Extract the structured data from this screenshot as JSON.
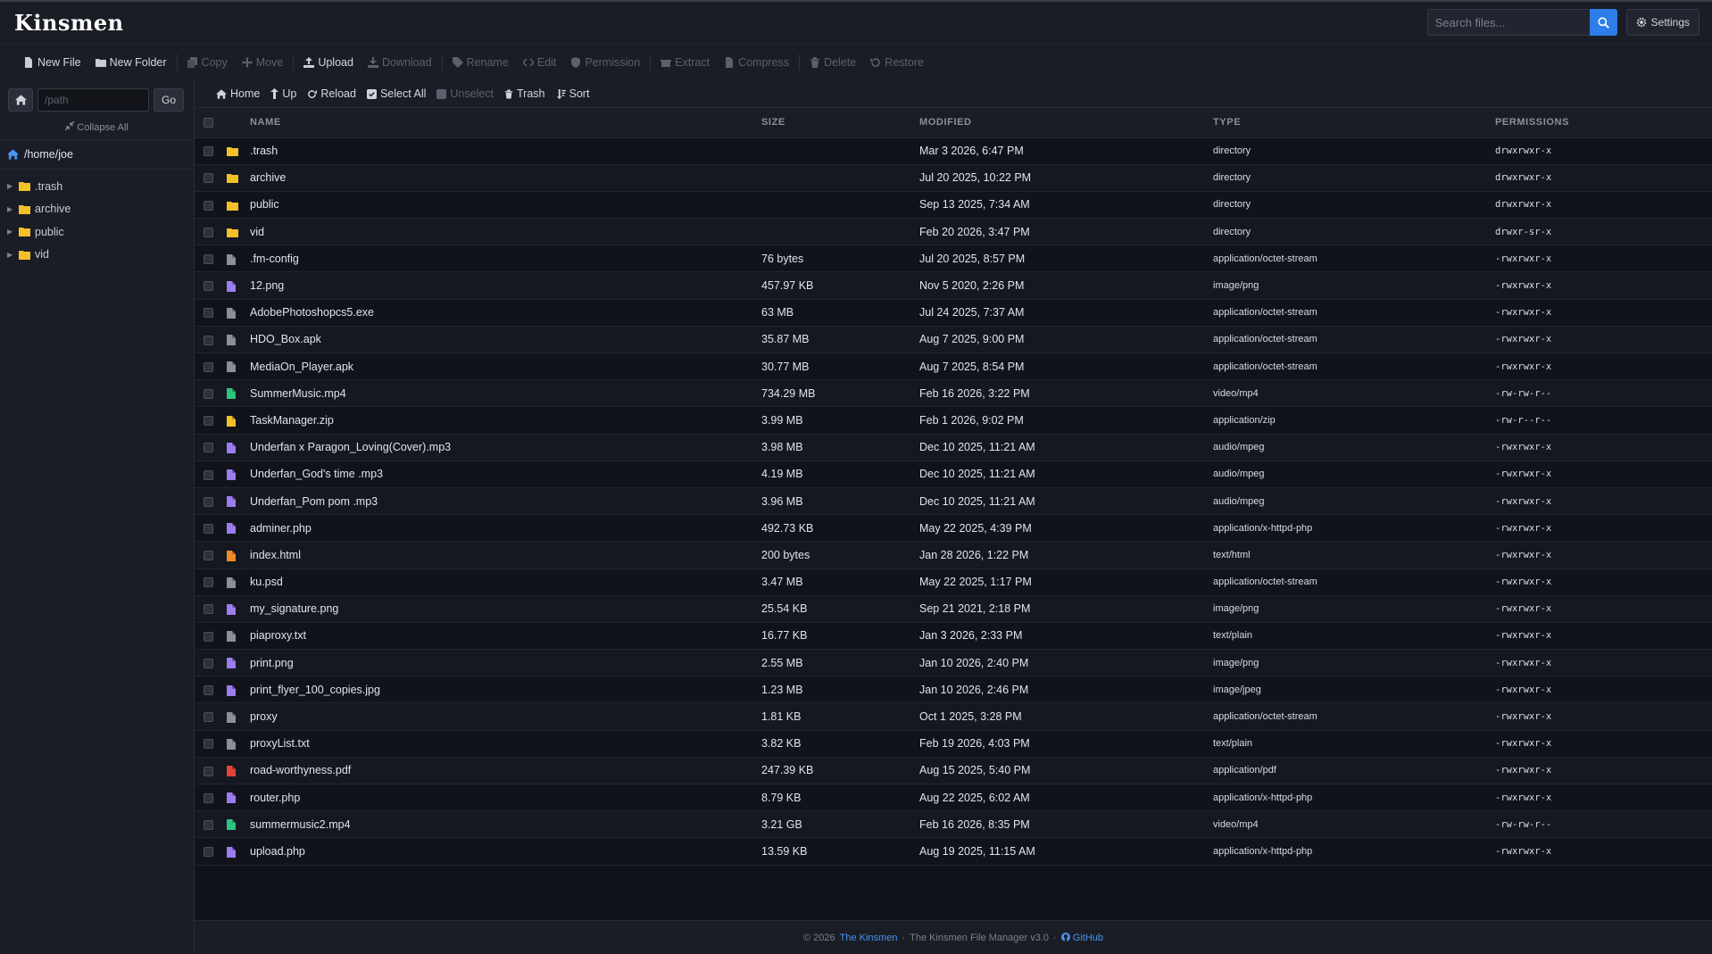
{
  "header": {
    "logo": "Kinsmen",
    "search_placeholder": "Search files...",
    "settings_label": "Settings"
  },
  "toolbar": {
    "new_file": "New File",
    "new_folder": "New Folder",
    "copy": "Copy",
    "move": "Move",
    "upload": "Upload",
    "download": "Download",
    "rename": "Rename",
    "edit": "Edit",
    "permission": "Permission",
    "extract": "Extract",
    "compress": "Compress",
    "delete": "Delete",
    "restore": "Restore"
  },
  "sidebar": {
    "path_placeholder": "/path",
    "go_label": "Go",
    "collapse_label": "Collapse All",
    "root": "/home/joe",
    "tree": [
      {
        "label": ".trash"
      },
      {
        "label": "archive"
      },
      {
        "label": "public"
      },
      {
        "label": "vid"
      }
    ]
  },
  "subtoolbar": {
    "home": "Home",
    "up": "Up",
    "reload": "Reload",
    "select_all": "Select All",
    "unselect": "Unselect",
    "trash": "Trash",
    "sort": "Sort"
  },
  "table": {
    "columns": [
      "NAME",
      "SIZE",
      "MODIFIED",
      "TYPE",
      "PERMISSIONS"
    ],
    "rows": [
      {
        "icon": "folder",
        "name": ".trash",
        "size": "",
        "modified": "Mar 3 2026, 6:47 PM",
        "type": "directory",
        "perm": "drwxrwxr-x"
      },
      {
        "icon": "folder",
        "name": "archive",
        "size": "",
        "modified": "Jul 20 2025, 10:22 PM",
        "type": "directory",
        "perm": "drwxrwxr-x"
      },
      {
        "icon": "folder",
        "name": "public",
        "size": "",
        "modified": "Sep 13 2025, 7:34 AM",
        "type": "directory",
        "perm": "drwxrwxr-x"
      },
      {
        "icon": "folder",
        "name": "vid",
        "size": "",
        "modified": "Feb 20 2026, 3:47 PM",
        "type": "directory",
        "perm": "drwxr-sr-x"
      },
      {
        "icon": "file-gray",
        "name": ".fm-config",
        "size": "76 bytes",
        "modified": "Jul 20 2025, 8:57 PM",
        "type": "application/octet-stream",
        "perm": "-rwxrwxr-x"
      },
      {
        "icon": "file-purple",
        "name": "12.png",
        "size": "457.97 KB",
        "modified": "Nov 5 2020, 2:26 PM",
        "type": "image/png",
        "perm": "-rwxrwxr-x"
      },
      {
        "icon": "file-gray",
        "name": "AdobePhotoshopcs5.exe",
        "size": "63 MB",
        "modified": "Jul 24 2025, 7:37 AM",
        "type": "application/octet-stream",
        "perm": "-rwxrwxr-x"
      },
      {
        "icon": "file-gray",
        "name": "HDO_Box.apk",
        "size": "35.87 MB",
        "modified": "Aug 7 2025, 9:00 PM",
        "type": "application/octet-stream",
        "perm": "-rwxrwxr-x"
      },
      {
        "icon": "file-gray",
        "name": "MediaOn_Player.apk",
        "size": "30.77 MB",
        "modified": "Aug 7 2025, 8:54 PM",
        "type": "application/octet-stream",
        "perm": "-rwxrwxr-x"
      },
      {
        "icon": "file-green",
        "name": "SummerMusic.mp4",
        "size": "734.29 MB",
        "modified": "Feb 16 2026, 3:22 PM",
        "type": "video/mp4",
        "perm": "-rw-rw-r--"
      },
      {
        "icon": "file-yellow",
        "name": "TaskManager.zip",
        "size": "3.99 MB",
        "modified": "Feb 1 2026, 9:02 PM",
        "type": "application/zip",
        "perm": "-rw-r--r--"
      },
      {
        "icon": "file-purple",
        "name": "Underfan x Paragon_Loving(Cover).mp3",
        "size": "3.98 MB",
        "modified": "Dec 10 2025, 11:21 AM",
        "type": "audio/mpeg",
        "perm": "-rwxrwxr-x"
      },
      {
        "icon": "file-purple",
        "name": "Underfan_God's time .mp3",
        "size": "4.19 MB",
        "modified": "Dec 10 2025, 11:21 AM",
        "type": "audio/mpeg",
        "perm": "-rwxrwxr-x"
      },
      {
        "icon": "file-purple",
        "name": "Underfan_Pom pom .mp3",
        "size": "3.96 MB",
        "modified": "Dec 10 2025, 11:21 AM",
        "type": "audio/mpeg",
        "perm": "-rwxrwxr-x"
      },
      {
        "icon": "file-purple",
        "name": "adminer.php",
        "size": "492.73 KB",
        "modified": "May 22 2025, 4:39 PM",
        "type": "application/x-httpd-php",
        "perm": "-rwxrwxr-x"
      },
      {
        "icon": "file-orange",
        "name": "index.html",
        "size": "200 bytes",
        "modified": "Jan 28 2026, 1:22 PM",
        "type": "text/html",
        "perm": "-rwxrwxr-x"
      },
      {
        "icon": "file-gray",
        "name": "ku.psd",
        "size": "3.47 MB",
        "modified": "May 22 2025, 1:17 PM",
        "type": "application/octet-stream",
        "perm": "-rwxrwxr-x"
      },
      {
        "icon": "file-purple",
        "name": "my_signature.png",
        "size": "25.54 KB",
        "modified": "Sep 21 2021, 2:18 PM",
        "type": "image/png",
        "perm": "-rwxrwxr-x"
      },
      {
        "icon": "file-gray",
        "name": "piaproxy.txt",
        "size": "16.77 KB",
        "modified": "Jan 3 2026, 2:33 PM",
        "type": "text/plain",
        "perm": "-rwxrwxr-x"
      },
      {
        "icon": "file-purple",
        "name": "print.png",
        "size": "2.55 MB",
        "modified": "Jan 10 2026, 2:40 PM",
        "type": "image/png",
        "perm": "-rwxrwxr-x"
      },
      {
        "icon": "file-purple",
        "name": "print_flyer_100_copies.jpg",
        "size": "1.23 MB",
        "modified": "Jan 10 2026, 2:46 PM",
        "type": "image/jpeg",
        "perm": "-rwxrwxr-x"
      },
      {
        "icon": "file-gray",
        "name": "proxy",
        "size": "1.81 KB",
        "modified": "Oct 1 2025, 3:28 PM",
        "type": "application/octet-stream",
        "perm": "-rwxrwxr-x"
      },
      {
        "icon": "file-gray",
        "name": "proxyList.txt",
        "size": "3.82 KB",
        "modified": "Feb 19 2026, 4:03 PM",
        "type": "text/plain",
        "perm": "-rwxrwxr-x"
      },
      {
        "icon": "file-red",
        "name": "road-worthyness.pdf",
        "size": "247.39 KB",
        "modified": "Aug 15 2025, 5:40 PM",
        "type": "application/pdf",
        "perm": "-rwxrwxr-x"
      },
      {
        "icon": "file-purple",
        "name": "router.php",
        "size": "8.79 KB",
        "modified": "Aug 22 2025, 6:02 AM",
        "type": "application/x-httpd-php",
        "perm": "-rwxrwxr-x"
      },
      {
        "icon": "file-green",
        "name": "summermusic2.mp4",
        "size": "3.21 GB",
        "modified": "Feb 16 2026, 8:35 PM",
        "type": "video/mp4",
        "perm": "-rw-rw-r--"
      },
      {
        "icon": "file-purple",
        "name": "upload.php",
        "size": "13.59 KB",
        "modified": "Aug 19 2025, 11:15 AM",
        "type": "application/x-httpd-php",
        "perm": "-rwxrwxr-x"
      }
    ]
  },
  "footer": {
    "copyright": "© 2026",
    "brand_link": "The Kinsmen",
    "sep1": "·",
    "product": "The Kinsmen File Manager v3.0",
    "sep2": "·",
    "github": "GitHub"
  },
  "colors": {
    "accent": "#2d7ee8",
    "folder": "#f4c02a",
    "file-gray": "#8a8f9a",
    "file-purple": "#9b7df0",
    "file-green": "#2ec27e",
    "file-yellow": "#f4c02a",
    "file-orange": "#f08a24",
    "file-red": "#e0443a"
  }
}
